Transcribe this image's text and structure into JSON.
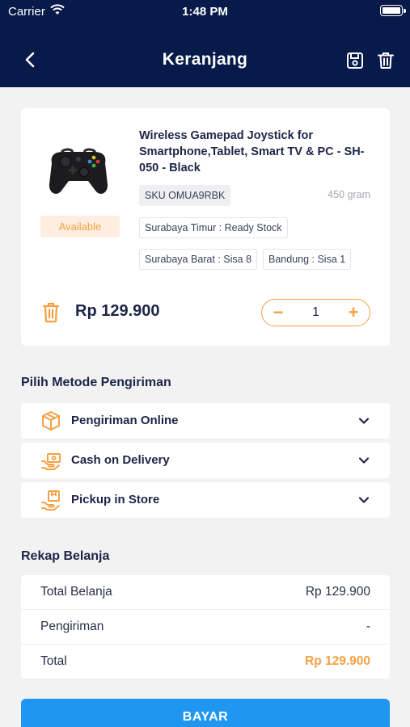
{
  "status_bar": {
    "carrier": "Carrier",
    "time": "1:48 PM"
  },
  "header": {
    "title": "Keranjang",
    "back_icon": "chevron-left-icon",
    "save_icon": "save-icon",
    "delete_icon": "trash-icon"
  },
  "product": {
    "name": "Wireless Gamepad Joystick for Smartphone,Tablet, Smart TV & PC - SH-050 - Black",
    "availability": "Available",
    "sku": "SKU OMUA9RBK",
    "weight": "450 gram",
    "stock": [
      "Surabaya Timur : Ready Stock",
      "Surabaya Barat : Sisa 8",
      "Bandung : Sisa 1"
    ],
    "price": "Rp 129.900",
    "quantity": "1",
    "minus_label": "−",
    "plus_label": "+"
  },
  "shipping": {
    "title": "Pilih Metode Pengiriman",
    "options": [
      {
        "label": "Pengiriman Online",
        "icon": "package-icon"
      },
      {
        "label": "Cash on Delivery",
        "icon": "cash-hand-icon"
      },
      {
        "label": "Pickup in Store",
        "icon": "store-pickup-icon"
      }
    ]
  },
  "summary": {
    "title": "Rekap Belanja",
    "rows": [
      {
        "label": "Total Belanja",
        "value": "Rp 129.900"
      },
      {
        "label": "Pengiriman",
        "value": "-"
      },
      {
        "label": "Total",
        "value": "Rp 129.900"
      }
    ]
  },
  "pay_button": "BAYAR",
  "colors": {
    "header_bg": "#071a4a",
    "accent": "#f5a042",
    "pay_button": "#1f96f0",
    "background": "#f2f2f3"
  }
}
